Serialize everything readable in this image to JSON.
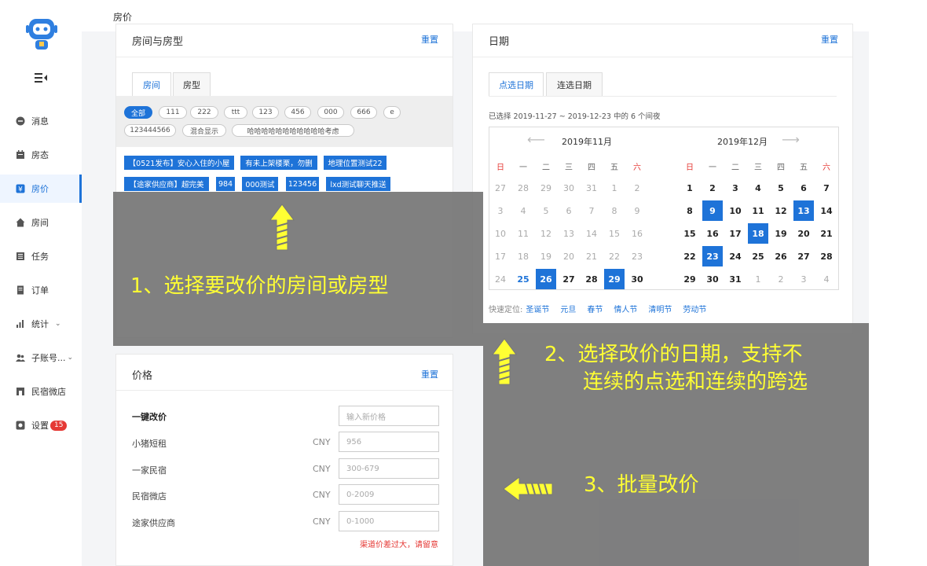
{
  "sidebar": {
    "items": [
      {
        "label": "消息",
        "icon": "message-icon"
      },
      {
        "label": "房态",
        "icon": "calendar-icon"
      },
      {
        "label": "房价",
        "icon": "yen-icon"
      },
      {
        "label": "房间",
        "icon": "home-icon"
      },
      {
        "label": "任务",
        "icon": "task-icon"
      },
      {
        "label": "订单",
        "icon": "order-icon"
      },
      {
        "label": "统计",
        "icon": "chart-icon"
      },
      {
        "label": "子账号...",
        "icon": "users-icon"
      },
      {
        "label": "民宿微店",
        "icon": "shop-icon"
      },
      {
        "label": "设置",
        "icon": "settings-icon",
        "badge": "15"
      }
    ],
    "active_index": 2
  },
  "header": {
    "title": "房价"
  },
  "rooms_card": {
    "title": "房间与房型",
    "reset": "重置",
    "tabs": [
      "房间",
      "房型"
    ],
    "chips": [
      "全部",
      "111",
      "222",
      "ttt",
      "123",
      "456",
      "000",
      "666",
      "e",
      "123444566",
      "混合显示",
      "哈哈哈哈哈哈哈哈哈哈哈考虑"
    ],
    "rooms": [
      "【0521发布】安心入住的小屋",
      "有未上架楼栗，勿删",
      "地理位置测试22",
      "【途家供应商】超完美",
      "984",
      "000测试",
      "123456",
      "lxd测试聊天推送"
    ]
  },
  "date_card": {
    "title": "日期",
    "reset": "重置",
    "tabs": [
      "点选日期",
      "连选日期"
    ],
    "summary": "已选择 2019-11-27 ~ 2019-12-23 中的 6 个间夜",
    "month_left": "2019年11月",
    "month_right": "2019年12月",
    "weekdays": [
      "日",
      "一",
      "二",
      "三",
      "四",
      "五",
      "六"
    ],
    "nov": [
      [
        "27",
        "28",
        "29",
        "30",
        "31",
        "1",
        "2"
      ],
      [
        "3",
        "4",
        "5",
        "6",
        "7",
        "8",
        "9"
      ],
      [
        "10",
        "11",
        "12",
        "13",
        "14",
        "15",
        "16"
      ],
      [
        "17",
        "18",
        "19",
        "20",
        "21",
        "22",
        "23"
      ],
      [
        "24",
        "25",
        "26",
        "27",
        "28",
        "29",
        "30"
      ]
    ],
    "dec": [
      [
        "1",
        "2",
        "3",
        "4",
        "5",
        "6",
        "7"
      ],
      [
        "8",
        "9",
        "10",
        "11",
        "12",
        "13",
        "14"
      ],
      [
        "15",
        "16",
        "17",
        "18",
        "19",
        "20",
        "21"
      ],
      [
        "22",
        "23",
        "24",
        "25",
        "26",
        "27",
        "28"
      ],
      [
        "29",
        "30",
        "31",
        "1",
        "2",
        "3",
        "4"
      ]
    ],
    "quick_label": "快速定位:",
    "quick_links": [
      "圣诞节",
      "元旦",
      "春节",
      "情人节",
      "清明节",
      "劳动节"
    ]
  },
  "price_card": {
    "title": "价格",
    "reset": "重置",
    "one_click_label": "一键改价",
    "one_click_placeholder": "输入新价格",
    "currency": "CNY",
    "channels": [
      {
        "name": "小猪短租",
        "value": "956"
      },
      {
        "name": "一家民宿",
        "value": "300-679"
      },
      {
        "name": "民宿微店",
        "value": "0-2009"
      },
      {
        "name": "途家供应商",
        "value": "0-1000"
      }
    ],
    "warning": "渠道价差过大，请留意"
  },
  "annotations": {
    "step1": "1、选择要改价的房间或房型",
    "step2_line1": "2、选择改价的日期，支持不",
    "step2_line2": "连续的点选和连续的跨选",
    "step3": "3、批量改价"
  },
  "colors": {
    "accent": "#1e73d8",
    "annotation": "#ffff33",
    "warning": "#e53935"
  }
}
